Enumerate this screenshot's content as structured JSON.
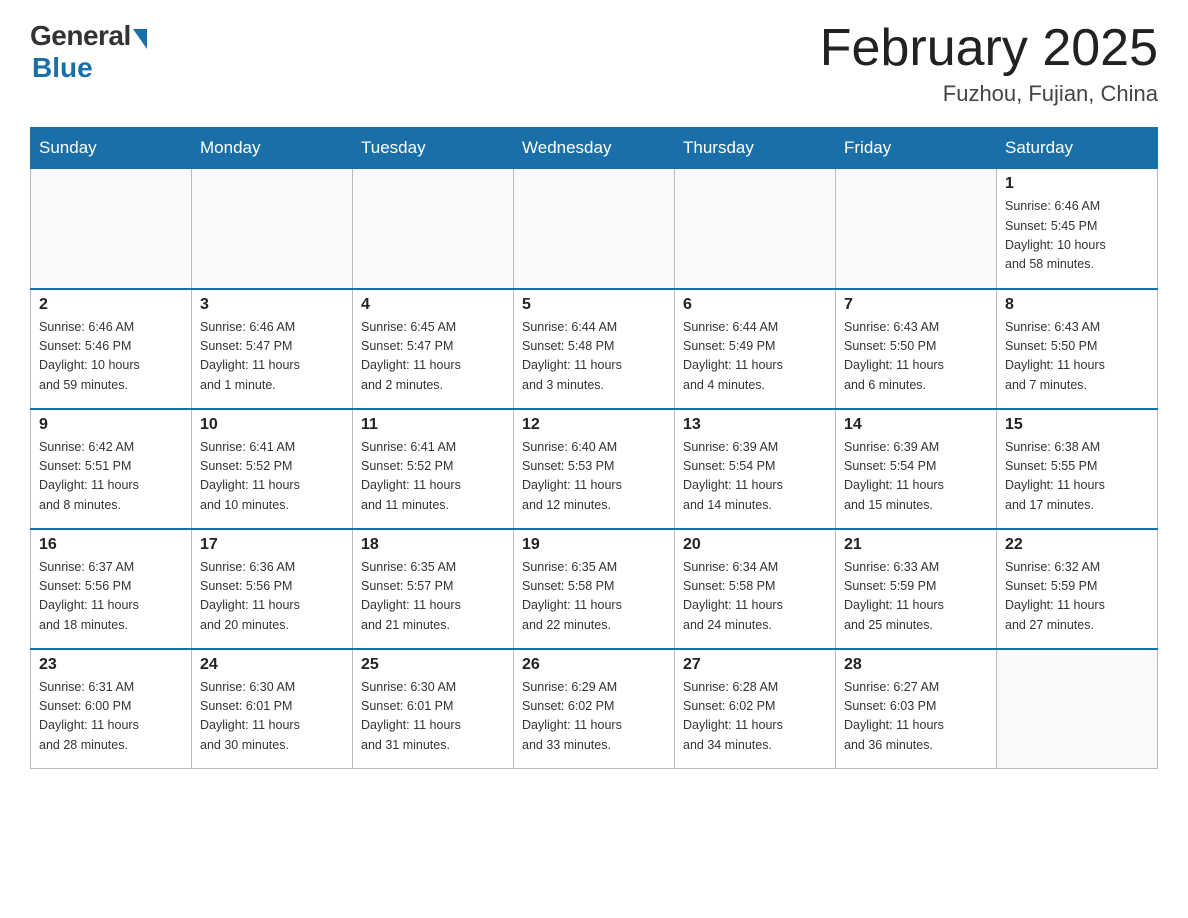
{
  "logo": {
    "general": "General",
    "blue": "Blue"
  },
  "header": {
    "month_title": "February 2025",
    "location": "Fuzhou, Fujian, China"
  },
  "weekdays": [
    "Sunday",
    "Monday",
    "Tuesday",
    "Wednesday",
    "Thursday",
    "Friday",
    "Saturday"
  ],
  "weeks": [
    [
      {
        "day": "",
        "info": ""
      },
      {
        "day": "",
        "info": ""
      },
      {
        "day": "",
        "info": ""
      },
      {
        "day": "",
        "info": ""
      },
      {
        "day": "",
        "info": ""
      },
      {
        "day": "",
        "info": ""
      },
      {
        "day": "1",
        "info": "Sunrise: 6:46 AM\nSunset: 5:45 PM\nDaylight: 10 hours\nand 58 minutes."
      }
    ],
    [
      {
        "day": "2",
        "info": "Sunrise: 6:46 AM\nSunset: 5:46 PM\nDaylight: 10 hours\nand 59 minutes."
      },
      {
        "day": "3",
        "info": "Sunrise: 6:46 AM\nSunset: 5:47 PM\nDaylight: 11 hours\nand 1 minute."
      },
      {
        "day": "4",
        "info": "Sunrise: 6:45 AM\nSunset: 5:47 PM\nDaylight: 11 hours\nand 2 minutes."
      },
      {
        "day": "5",
        "info": "Sunrise: 6:44 AM\nSunset: 5:48 PM\nDaylight: 11 hours\nand 3 minutes."
      },
      {
        "day": "6",
        "info": "Sunrise: 6:44 AM\nSunset: 5:49 PM\nDaylight: 11 hours\nand 4 minutes."
      },
      {
        "day": "7",
        "info": "Sunrise: 6:43 AM\nSunset: 5:50 PM\nDaylight: 11 hours\nand 6 minutes."
      },
      {
        "day": "8",
        "info": "Sunrise: 6:43 AM\nSunset: 5:50 PM\nDaylight: 11 hours\nand 7 minutes."
      }
    ],
    [
      {
        "day": "9",
        "info": "Sunrise: 6:42 AM\nSunset: 5:51 PM\nDaylight: 11 hours\nand 8 minutes."
      },
      {
        "day": "10",
        "info": "Sunrise: 6:41 AM\nSunset: 5:52 PM\nDaylight: 11 hours\nand 10 minutes."
      },
      {
        "day": "11",
        "info": "Sunrise: 6:41 AM\nSunset: 5:52 PM\nDaylight: 11 hours\nand 11 minutes."
      },
      {
        "day": "12",
        "info": "Sunrise: 6:40 AM\nSunset: 5:53 PM\nDaylight: 11 hours\nand 12 minutes."
      },
      {
        "day": "13",
        "info": "Sunrise: 6:39 AM\nSunset: 5:54 PM\nDaylight: 11 hours\nand 14 minutes."
      },
      {
        "day": "14",
        "info": "Sunrise: 6:39 AM\nSunset: 5:54 PM\nDaylight: 11 hours\nand 15 minutes."
      },
      {
        "day": "15",
        "info": "Sunrise: 6:38 AM\nSunset: 5:55 PM\nDaylight: 11 hours\nand 17 minutes."
      }
    ],
    [
      {
        "day": "16",
        "info": "Sunrise: 6:37 AM\nSunset: 5:56 PM\nDaylight: 11 hours\nand 18 minutes."
      },
      {
        "day": "17",
        "info": "Sunrise: 6:36 AM\nSunset: 5:56 PM\nDaylight: 11 hours\nand 20 minutes."
      },
      {
        "day": "18",
        "info": "Sunrise: 6:35 AM\nSunset: 5:57 PM\nDaylight: 11 hours\nand 21 minutes."
      },
      {
        "day": "19",
        "info": "Sunrise: 6:35 AM\nSunset: 5:58 PM\nDaylight: 11 hours\nand 22 minutes."
      },
      {
        "day": "20",
        "info": "Sunrise: 6:34 AM\nSunset: 5:58 PM\nDaylight: 11 hours\nand 24 minutes."
      },
      {
        "day": "21",
        "info": "Sunrise: 6:33 AM\nSunset: 5:59 PM\nDaylight: 11 hours\nand 25 minutes."
      },
      {
        "day": "22",
        "info": "Sunrise: 6:32 AM\nSunset: 5:59 PM\nDaylight: 11 hours\nand 27 minutes."
      }
    ],
    [
      {
        "day": "23",
        "info": "Sunrise: 6:31 AM\nSunset: 6:00 PM\nDaylight: 11 hours\nand 28 minutes."
      },
      {
        "day": "24",
        "info": "Sunrise: 6:30 AM\nSunset: 6:01 PM\nDaylight: 11 hours\nand 30 minutes."
      },
      {
        "day": "25",
        "info": "Sunrise: 6:30 AM\nSunset: 6:01 PM\nDaylight: 11 hours\nand 31 minutes."
      },
      {
        "day": "26",
        "info": "Sunrise: 6:29 AM\nSunset: 6:02 PM\nDaylight: 11 hours\nand 33 minutes."
      },
      {
        "day": "27",
        "info": "Sunrise: 6:28 AM\nSunset: 6:02 PM\nDaylight: 11 hours\nand 34 minutes."
      },
      {
        "day": "28",
        "info": "Sunrise: 6:27 AM\nSunset: 6:03 PM\nDaylight: 11 hours\nand 36 minutes."
      },
      {
        "day": "",
        "info": ""
      }
    ]
  ]
}
